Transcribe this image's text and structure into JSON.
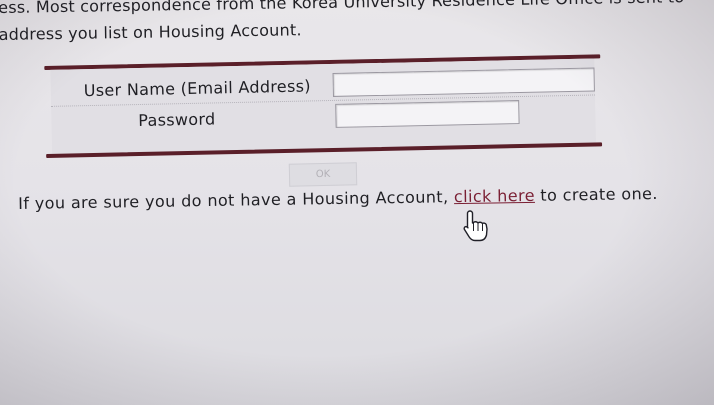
{
  "intro": {
    "line1": "ess. Most correspondence from the Korea University Residence Life Office is sent to",
    "line2": "address you list on Housing Account."
  },
  "form": {
    "username_label": "User Name (Email Address)",
    "password_label": "Password",
    "username_value": "",
    "password_value": "",
    "ok_label": "OK"
  },
  "footer": {
    "prefix": "If you are sure you do not have a Housing Account, ",
    "link_text": "click here",
    "suffix": " to create one."
  },
  "colors": {
    "bar": "#5a1f29",
    "link": "#7a1f34",
    "background": "#e6e4e8"
  },
  "icons": {
    "cursor": "hand-pointer-icon"
  }
}
